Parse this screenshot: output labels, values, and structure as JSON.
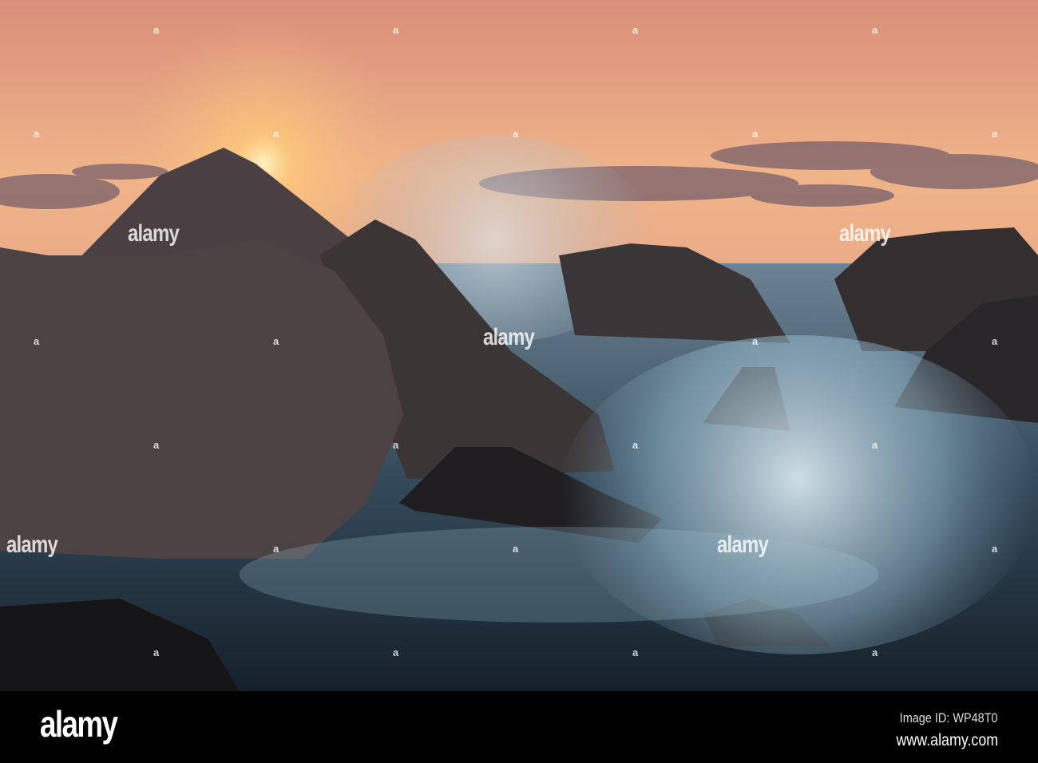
{
  "watermark": {
    "text": "alamy",
    "mark": "a"
  },
  "footer": {
    "logo": "alamy",
    "image_id": "Image ID: WP48T0",
    "website": "www.alamy.com"
  },
  "colors": {
    "sky_top": "#e9a57e",
    "sun": "#ffd98a",
    "rock": "#2c2a2b",
    "water": "#8fb3c4"
  }
}
